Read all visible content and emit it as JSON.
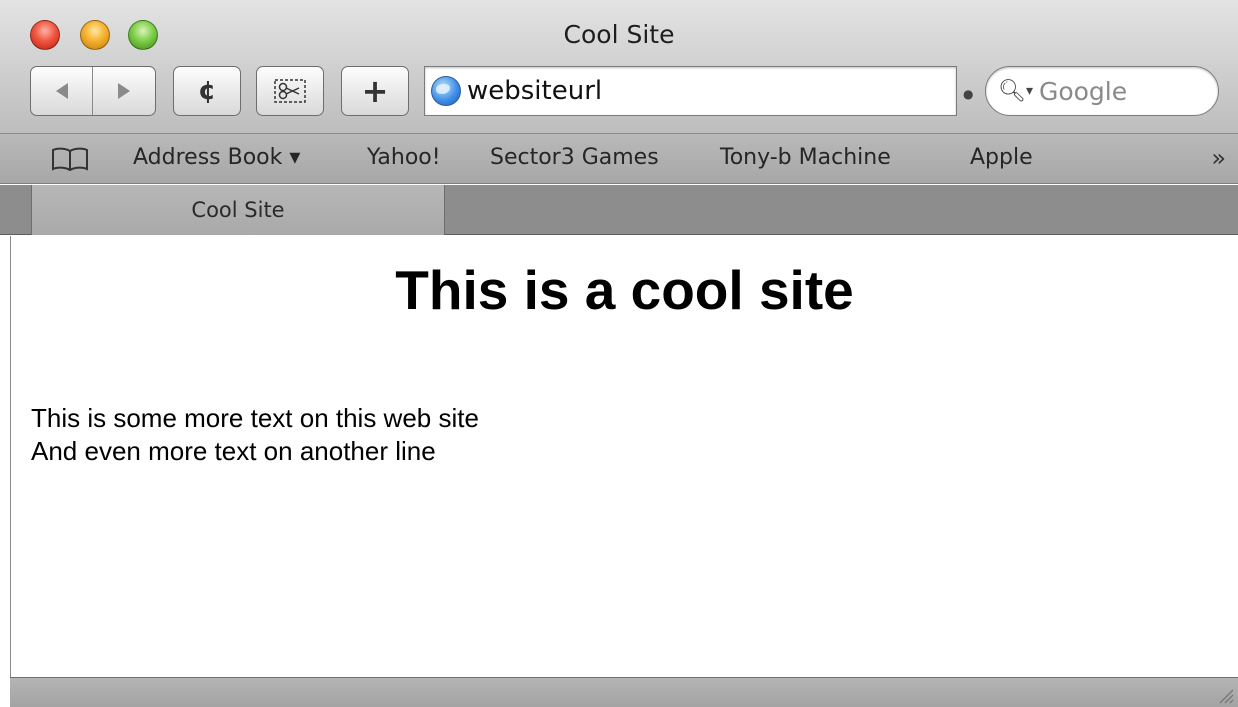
{
  "window": {
    "title": "Cool Site"
  },
  "toolbar": {
    "back_icon": "back-arrow-icon",
    "forward_icon": "forward-arrow-icon",
    "reload_glyph": "¢",
    "snippet_icon": "scissors-icon",
    "add_glyph": "+",
    "address": {
      "value": "websiteurl"
    },
    "search": {
      "placeholder": "Google"
    }
  },
  "bookmarks": {
    "items": [
      {
        "label": "Address Book ▾"
      },
      {
        "label": "Yahoo!"
      },
      {
        "label": "Sector3 Games"
      },
      {
        "label": "Tony-b Machine"
      },
      {
        "label": "Apple"
      }
    ],
    "overflow": "»"
  },
  "tabs": [
    {
      "label": "Cool Site",
      "active": true
    }
  ],
  "page": {
    "heading": "This is a cool site",
    "lines": [
      "This is some more text on this web site",
      "And even more text on another line"
    ]
  },
  "colors": {
    "close": "#f0563f",
    "minimize": "#f5b12e",
    "zoom": "#7fce4a",
    "globe": "#3f8ee8"
  }
}
